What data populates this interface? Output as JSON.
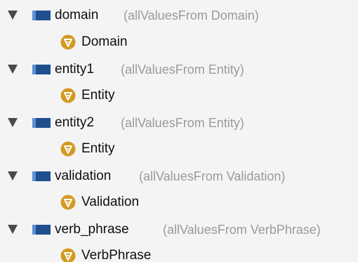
{
  "properties": [
    {
      "name": "domain",
      "restriction": "(allValuesFrom Domain)",
      "value": "Domain",
      "icon": "object-property-icon",
      "value_icon": "class-all-values-icon"
    },
    {
      "name": "entity1",
      "restriction": "(allValuesFrom Entity)",
      "value": "Entity",
      "icon": "object-property-icon",
      "value_icon": "class-all-values-icon"
    },
    {
      "name": "entity2",
      "restriction": "(allValuesFrom Entity)",
      "value": "Entity",
      "icon": "object-property-icon",
      "value_icon": "class-all-values-icon"
    },
    {
      "name": "validation",
      "restriction": "(allValuesFrom Validation)",
      "value": "Validation",
      "icon": "object-property-icon",
      "value_icon": "class-all-values-icon"
    },
    {
      "name": "verb_phrase",
      "restriction": "(allValuesFrom VerbPhrase)",
      "value": "VerbPhrase",
      "icon": "object-property-icon",
      "value_icon": "class-all-values-icon"
    }
  ],
  "colors": {
    "background": "#f4f4f4",
    "property_icon": "#1f4f8f",
    "value_icon": "#d39a23",
    "restriction_text": "#9a9a9a"
  }
}
